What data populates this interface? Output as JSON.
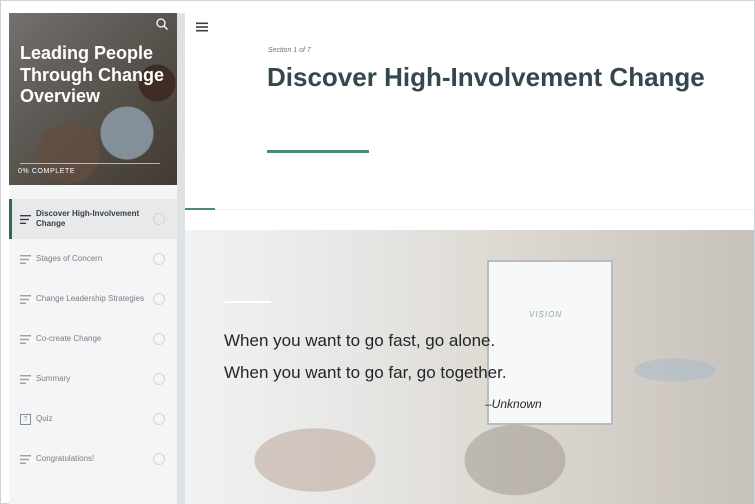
{
  "course": {
    "title": "Leading People Through Change Overview",
    "progress_label": "0% COMPLETE",
    "progress_percent": 0
  },
  "sidebar": {
    "items": [
      {
        "label": "Discover High-Involvement Change",
        "icon": "lesson-lines-icon",
        "active": true
      },
      {
        "label": "Stages of Concern",
        "icon": "lesson-lines-icon",
        "active": false
      },
      {
        "label": "Change Leadership Strategies",
        "icon": "lesson-lines-icon",
        "active": false
      },
      {
        "label": "Co-create Change",
        "icon": "lesson-lines-icon",
        "active": false
      },
      {
        "label": "Summary",
        "icon": "lesson-lines-icon",
        "active": false
      },
      {
        "label": "Quiz",
        "icon": "quiz-icon",
        "active": false
      },
      {
        "label": "Congratulations!",
        "icon": "lesson-lines-icon",
        "active": false
      }
    ]
  },
  "main": {
    "section_label": "Section 1 of 7",
    "title": "Discover High-Involvement Change",
    "quote": {
      "line1": "When you want to go fast, go alone.",
      "line2": "When you want to go far, go together.",
      "author": "–Unknown"
    },
    "board_text": "VISION"
  },
  "colors": {
    "accent": "#4f8b6e",
    "title_text": "#34474f",
    "sidebar_bg": "#f4f5f6"
  }
}
